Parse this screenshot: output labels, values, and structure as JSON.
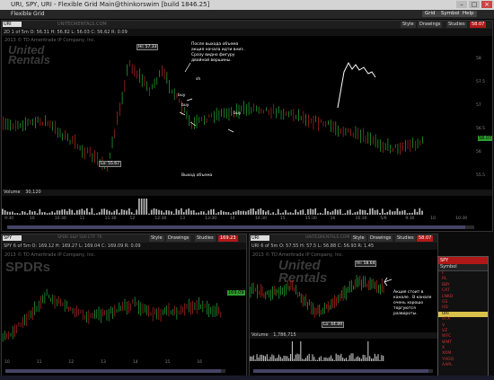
{
  "window": {
    "title": "URI, SPY, URI - Flexible Grid Main@thinkorswim [build 1846.25]"
  },
  "appbar": {
    "label": "Flexible Grid",
    "buttons": [
      "Grid",
      "Symbol",
      "Help"
    ]
  },
  "main_chart": {
    "symbol": "URI",
    "info": "2D 1 of 5m   O: 56.31   H: 56.82   L: 56.03   C: 56.62   R: 0.09",
    "company": "2013 © TD Ameritrade IP Company, Inc.",
    "watermark1": "United",
    "watermark2": "Rentals",
    "header_watermark": "UNITEDRENTALS.COM",
    "buttons": {
      "style": "Style",
      "drawings": "Drawings",
      "studies": "Studies"
    },
    "last_price": "58.07",
    "hi_label": "Hi: 57.33",
    "lo_label": "Lo: 55.67",
    "annotation": "После выхода объема акция начала идти вниз . Сразу видно фигуру двойной вершины.",
    "sh": "sh",
    "buy1": "buy",
    "buy2": "buy",
    "buy3": "buy",
    "volume_note": "Выход объема",
    "volume_label": "Volume",
    "volume_value": "30,120",
    "y_ticks": [
      "58",
      "57.5",
      "57",
      "56.5",
      "56",
      "55.5"
    ],
    "x_ticks": [
      "9:30",
      "10",
      "10:30",
      "11",
      "11:30",
      "12",
      "12:30",
      "13",
      "13:30",
      "14",
      "14:30",
      "15",
      "15:30",
      "16",
      "16:30",
      "5/6",
      "9:30",
      "10",
      "10:30"
    ]
  },
  "spy_chart": {
    "symbol": "SPY",
    "header_watermark": "SPDR S&P 500 ETF TR",
    "info": "SPY 6 of 5m   O: 169.12   H: 169.27   L: 169.04   C: 169.09   R: 0.09",
    "company": "2013 © TD Ameritrade IP Company, Inc.",
    "watermark": "SPDRs",
    "price": "169.23",
    "last_tag": "169.09",
    "buttons": {
      "style": "Style",
      "drawings": "Drawings",
      "studies": "Studies"
    },
    "x_ticks": [
      "10",
      "11",
      "12",
      "13",
      "14",
      "15",
      "16"
    ]
  },
  "uri_small": {
    "symbol": "URI",
    "header_watermark": "UNITEDRENTALS.COM",
    "info": "URI 6 of 5m   O: 57.55   H: 57.5   L: 56.88   C: 56.93   R: 1.45",
    "company": "2013 © TD Ameritrade IP Company, Inc.",
    "watermark1": "United",
    "watermark2": "Rentals",
    "price": "58.07",
    "hi_label": "Hi: 58.64",
    "lo_label": "Lo: 44.89",
    "annotation": "Акция стоит в канале . В канале очень хорошо торгуются развороты.",
    "buttons": {
      "style": "Style",
      "drawings": "Drawings",
      "studies": "Studies"
    },
    "volume_label": "Volume",
    "volume_value": "1,786,715"
  },
  "watchlist": {
    "title": "SPY",
    "header": "Symbol",
    "items": [
      "F",
      "RL",
      "BBY",
      "CAT",
      "LNKD",
      "GS",
      "HD",
      "URI",
      "UTX",
      "V",
      "VZ",
      "WFC",
      "WMT",
      "X",
      "XOM",
      "YHOO",
      "AAPL"
    ],
    "selected": "URI"
  },
  "colors": {
    "up": "#2ecc40",
    "down": "#e0302a",
    "accent": "#b01818",
    "watchlist_selected": "#d8c24a"
  }
}
